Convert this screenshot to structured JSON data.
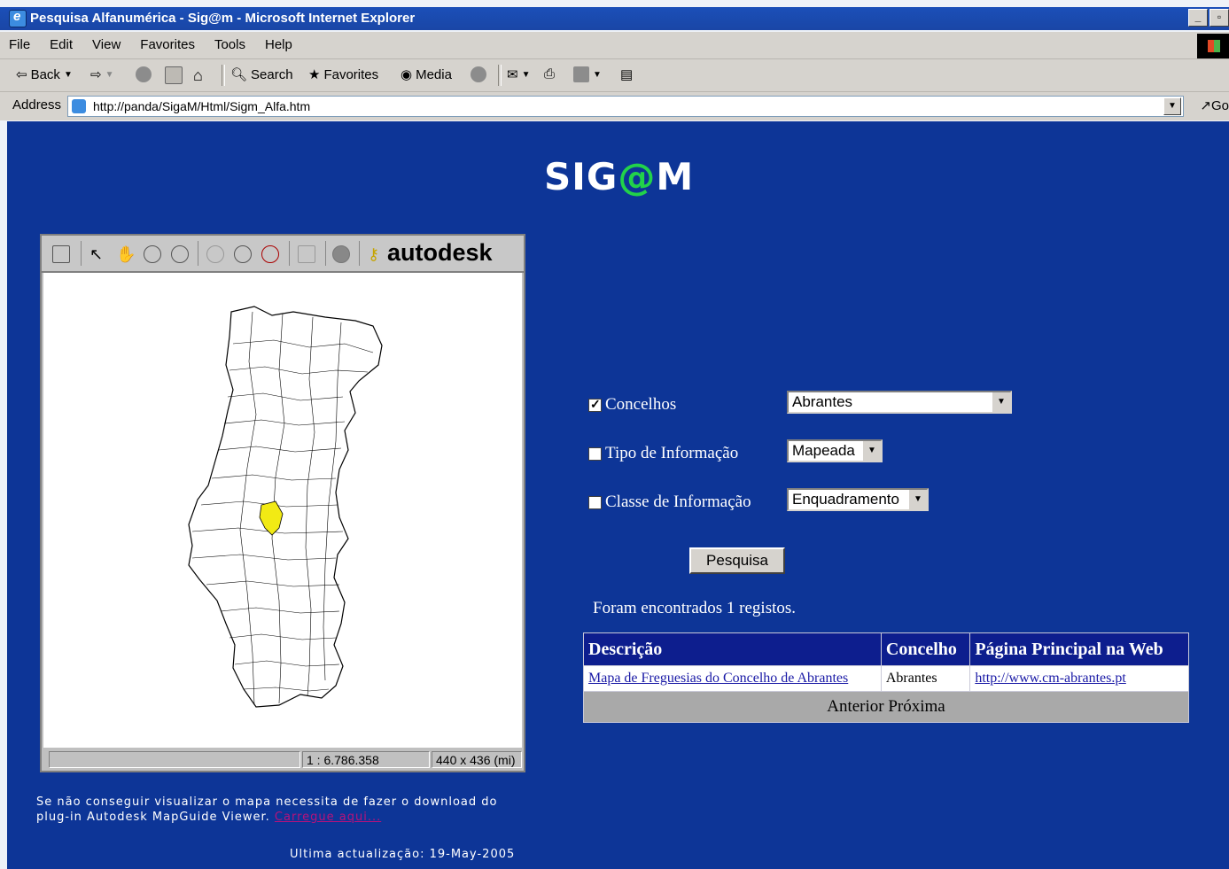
{
  "window": {
    "title": "Pesquisa Alfanumérica - Sig@m - Microsoft Internet Explorer"
  },
  "menu": [
    "File",
    "Edit",
    "View",
    "Favorites",
    "Tools",
    "Help"
  ],
  "toolbar": {
    "back": "Back",
    "search": "Search",
    "favorites": "Favorites",
    "media": "Media"
  },
  "address": {
    "label": "Address",
    "url": "http://panda/SigaM/Html/Sigm_Alfa.htm",
    "go": "Go"
  },
  "page": {
    "logo_left": "SIG",
    "logo_at": "@",
    "logo_right": "M",
    "map": {
      "brand": "autodesk",
      "scale": "1 : 6.786.358",
      "size": "440 x 436 (mi)"
    },
    "plugin_note": "Se não conseguir visualizar o mapa necessita de fazer o download do plug-in Autodesk MapGuide Viewer.",
    "plugin_link": "Carregue aqui...",
    "updated": "Ultima actualização: 19-May-2005",
    "form": {
      "concelhos": {
        "label": "Concelhos",
        "checked": true,
        "value": "Abrantes"
      },
      "tipo": {
        "label": "Tipo de Informação",
        "checked": false,
        "value": "Mapeada"
      },
      "classe": {
        "label": "Classe de Informação",
        "checked": false,
        "value": "Enquadramento"
      },
      "submit": "Pesquisa"
    },
    "found_text": "Foram encontrados 1 registos.",
    "results": {
      "headers": [
        "Descrição",
        "Concelho",
        "Página Principal na Web"
      ],
      "rows": [
        [
          "Mapa de Freguesias do Concelho de Abrantes",
          "Abrantes",
          "http://www.cm-abrantes.pt"
        ]
      ],
      "nav": {
        "prev": "Anterior",
        "next": "Próxima"
      }
    }
  }
}
